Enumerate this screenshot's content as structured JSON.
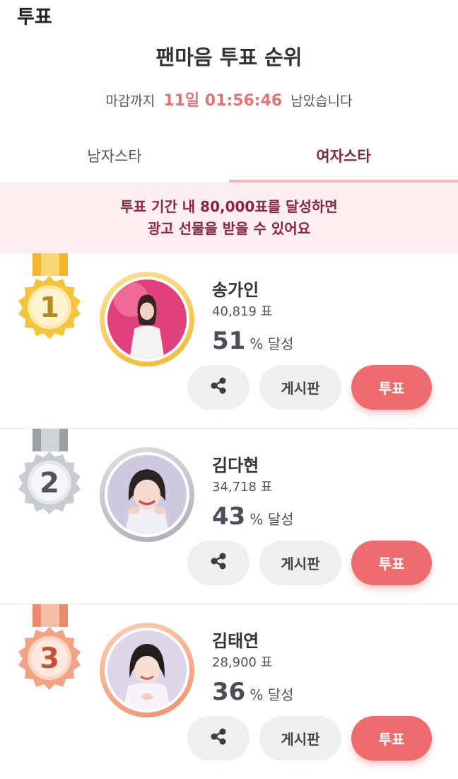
{
  "page": {
    "title": "투표",
    "heading": "팬마음 투표 순위",
    "countdown": {
      "prefix": "마감까지",
      "remaining": "11일 01:56:46",
      "suffix": "남았습니다"
    }
  },
  "tabs": [
    {
      "label": "남자스타",
      "active": false
    },
    {
      "label": "여자스타",
      "active": true
    }
  ],
  "notice": {
    "line1": "투표 기간 내 80,000표를 달성하면",
    "line2": "광고 선물을 받을 수 있어요"
  },
  "ranking": [
    {
      "rank": "1",
      "name": "송가인",
      "votes": "40,819 표",
      "percent": "51",
      "percent_unit": "%",
      "achieved": "달성",
      "board_label": "게시판",
      "vote_label": "투표"
    },
    {
      "rank": "2",
      "name": "김다현",
      "votes": "34,718 표",
      "percent": "43",
      "percent_unit": "%",
      "achieved": "달성",
      "board_label": "게시판",
      "vote_label": "투표"
    },
    {
      "rank": "3",
      "name": "김태연",
      "votes": "28,900 표",
      "percent": "36",
      "percent_unit": "%",
      "achieved": "달성",
      "board_label": "게시판",
      "vote_label": "투표"
    }
  ],
  "icons": {
    "share": "share-icon",
    "medal": "medal-icon"
  },
  "colors": {
    "accent": "#ee6c6e",
    "countdown": "#e57373",
    "notice_bg": "#fdeff0",
    "notice_text": "#8b2346",
    "gold": "#f1b82d",
    "silver": "#a9adb3",
    "bronze": "#ee8f6a"
  }
}
